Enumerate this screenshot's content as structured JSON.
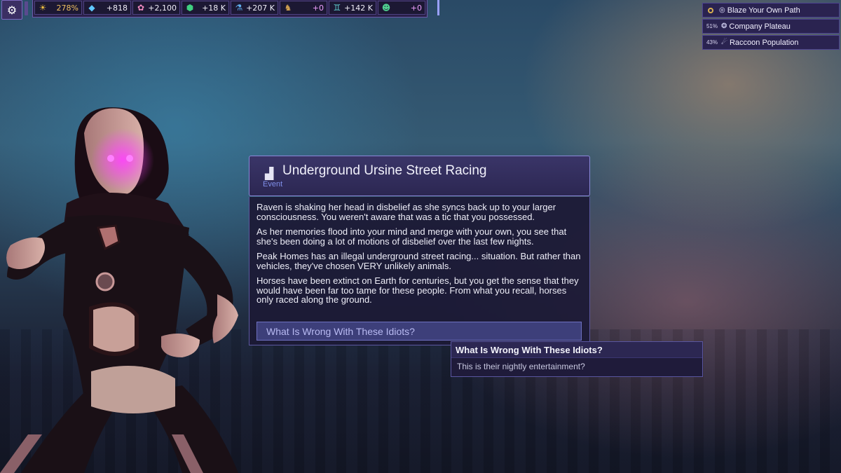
{
  "resources": [
    {
      "icon": "sun-icon",
      "glyph": "☀",
      "color": "#f0c040",
      "value": "278%",
      "state": "warn"
    },
    {
      "icon": "gem-icon",
      "glyph": "◆",
      "color": "#60c8ff",
      "value": "+818",
      "state": "normal"
    },
    {
      "icon": "brain-icon",
      "glyph": "✿",
      "color": "#f08ac0",
      "value": "+2,100",
      "state": "normal"
    },
    {
      "icon": "cube-icon",
      "glyph": "⬢",
      "color": "#40d080",
      "value": "+18 K",
      "state": "normal"
    },
    {
      "icon": "flask-icon",
      "glyph": "⚗",
      "color": "#60b0f0",
      "value": "+207 K",
      "state": "normal"
    },
    {
      "icon": "turtle-icon",
      "glyph": "♞",
      "color": "#d0a050",
      "value": "+0",
      "state": "zero"
    },
    {
      "icon": "people-icon",
      "glyph": "♊",
      "color": "#60d0d0",
      "value": "+142 K",
      "state": "normal"
    },
    {
      "icon": "head-icon",
      "glyph": "☻",
      "color": "#50d090",
      "value": "+0",
      "state": "zero"
    }
  ],
  "objectives": [
    {
      "pct": "",
      "icon": "target-circle-icon",
      "name": "Blaze Your Own Path"
    },
    {
      "pct": "51%",
      "icon": "company-icon",
      "name": "Company Plateau"
    },
    {
      "pct": "43%",
      "icon": "raccoon-icon",
      "name": "Raccoon Population"
    }
  ],
  "event": {
    "title": "Underground Ursine Street Racing",
    "kind": "Event",
    "paragraphs": [
      "Raven is shaking her head in disbelief as she syncs back up to your larger consciousness. You weren't aware that was a tic that you possessed.",
      "As her memories flood into your mind and merge with your own, you see that she's been doing a lot of motions of disbelief over the last few nights.",
      "Peak Homes has an illegal underground street racing... situation. But rather than vehicles, they've chosen VERY unlikely animals.",
      "Horses have been extinct on Earth for centuries, but you get the sense that they would have been far too tame for these people. From what you recall, horses only raced along the ground."
    ],
    "choice": "What Is Wrong With These Idiots?"
  },
  "tooltip": {
    "title": "What Is Wrong With These Idiots?",
    "body": "This is their nightly entertainment?"
  }
}
